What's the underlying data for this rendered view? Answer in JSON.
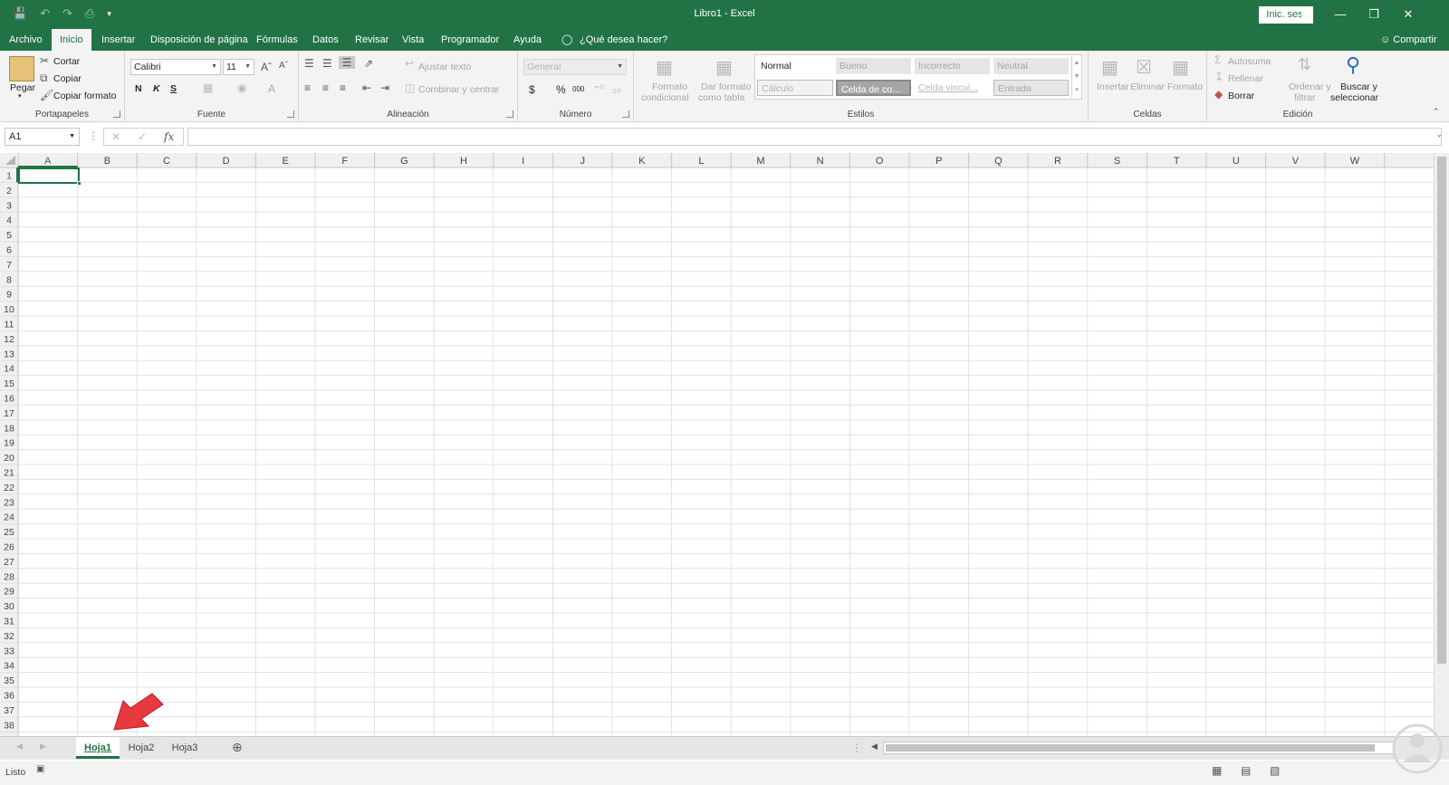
{
  "window": {
    "title": "Libro1  -  Excel",
    "signin_label": "Inic. ses.",
    "controls": [
      "ribbon-display-icon",
      "minimize-icon",
      "restore-icon",
      "close-icon"
    ]
  },
  "menu": {
    "tabs": [
      "Archivo",
      "Inicio",
      "Insertar",
      "Disposición de página",
      "Fórmulas",
      "Datos",
      "Revisar",
      "Vista",
      "Programador",
      "Ayuda"
    ],
    "active": "Inicio",
    "tell_me": "¿Qué desea hacer?",
    "share": "Compartir"
  },
  "ribbon": {
    "clipboard": {
      "paste": "Pegar",
      "cut": "Cortar",
      "copy": "Copiar",
      "format_painter": "Copiar formato",
      "label": "Portapapeles"
    },
    "font": {
      "name": "Calibri",
      "size": "11",
      "bold": "N",
      "italic": "K",
      "underline": "S",
      "font_color": "A",
      "label": "Fuente"
    },
    "alignment": {
      "wrap": "Ajustar texto",
      "merge": "Combinar y centrar",
      "label": "Alineación"
    },
    "number": {
      "format": "General",
      "currency": "$",
      "percent": "%",
      "thousands": "000",
      "label": "Número"
    },
    "styles_buttons": {
      "conditional": [
        "Formato",
        "condicional"
      ],
      "table": [
        "Dar formato",
        "como tabla"
      ],
      "label": "Estilos"
    },
    "styles": [
      "Normal",
      "Bueno",
      "Incorrecto",
      "Neutral",
      "Cálculo",
      "Celda de co...",
      "Celda vincul...",
      "Entrada"
    ],
    "cells": {
      "insert": "Insertar",
      "delete": "Eliminar",
      "format": "Formato",
      "label": "Celdas"
    },
    "editing": {
      "autosum": "Autosuma",
      "fill": "Rellenar",
      "clear": "Borrar",
      "sort": [
        "Ordenar y",
        "filtrar"
      ],
      "find": [
        "Buscar y",
        "seleccionar"
      ],
      "label": "Edición"
    }
  },
  "formula_bar": {
    "name_box": "A1",
    "fx": "fx",
    "value": ""
  },
  "grid": {
    "columns": [
      "A",
      "B",
      "C",
      "D",
      "E",
      "F",
      "G",
      "H",
      "I",
      "J",
      "K",
      "L",
      "M",
      "N",
      "O",
      "P",
      "Q",
      "R",
      "S",
      "T",
      "U",
      "V",
      "W"
    ],
    "row_count": 38,
    "selected_cell": "A1"
  },
  "sheets": {
    "tabs": [
      "Hoja1",
      "Hoja2",
      "Hoja3"
    ],
    "active": "Hoja1"
  },
  "status": {
    "text": "Listo"
  },
  "colors": {
    "accent": "#217346",
    "arrow": "#e8393f"
  }
}
